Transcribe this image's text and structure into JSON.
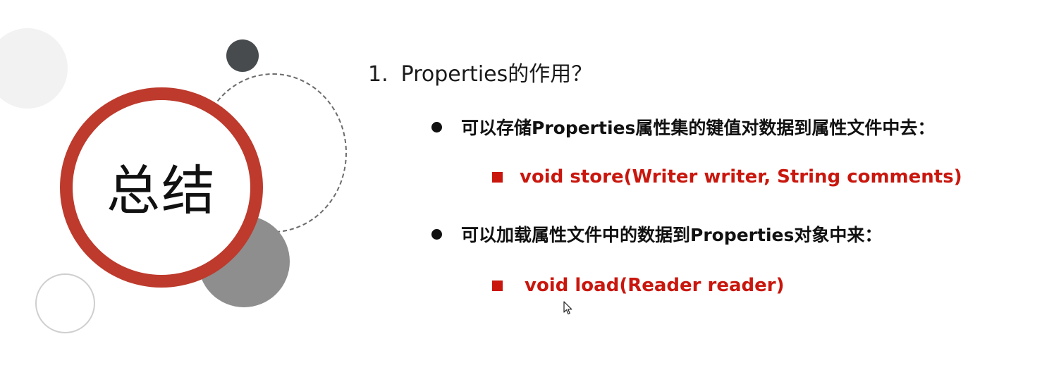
{
  "slide": {
    "badge_title": "总结",
    "heading": {
      "number": "1.",
      "text": "Properties的作用？"
    },
    "points": [
      {
        "bullet_text": "可以存储Properties属性集的键值对数据到属性文件中去：",
        "method": "void store(Writer writer, String comments)"
      },
      {
        "bullet_text": "可以加载属性文件中的数据到Properties对象中来：",
        "method": "void load(Reader reader)"
      }
    ]
  },
  "colors": {
    "accent_red": "#bd3a2c",
    "method_red": "#c9170e",
    "text_dark": "#111111",
    "circle_dark": "#474b4e",
    "circle_gray": "#8e8e8e"
  },
  "icons": [
    "bullet-dot-icon",
    "square-bullet-icon",
    "mouse-cursor-icon"
  ]
}
